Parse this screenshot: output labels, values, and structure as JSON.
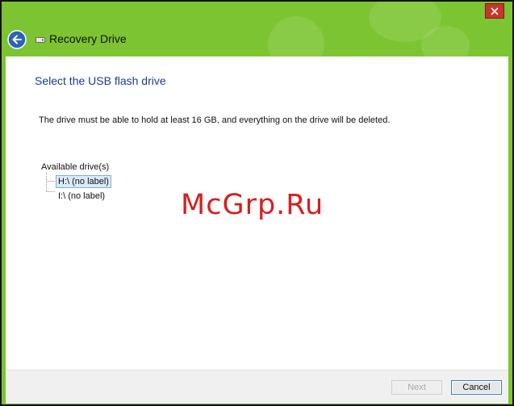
{
  "window": {
    "title": "Recovery Drive",
    "accent_color": "#7cc431",
    "close_icon": "close-icon",
    "back_icon": "back-arrow-icon",
    "app_icon": "usb-drive-icon"
  },
  "main": {
    "heading": "Select the USB flash drive",
    "description": "The drive must be able to hold at least 16 GB, and everything on the drive will be deleted.",
    "tree": {
      "label": "Available drive(s)",
      "items": [
        {
          "label": "H:\\ (no label)",
          "selected": true
        },
        {
          "label": "I:\\ (no label)",
          "selected": false
        }
      ]
    },
    "watermark": "McGrp.Ru"
  },
  "footer": {
    "next_label": "Next",
    "next_enabled": false,
    "cancel_label": "Cancel"
  }
}
